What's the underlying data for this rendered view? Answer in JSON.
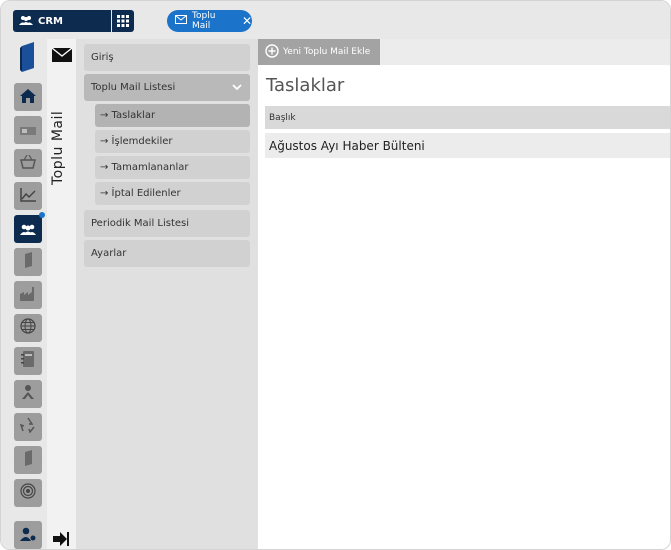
{
  "topbar": {
    "app_label": "CRM",
    "tab_label": "Toplu Mail",
    "tab_close": "✕"
  },
  "rail": {
    "icons": [
      "logo-icon",
      "home-icon",
      "card-icon",
      "basket-icon",
      "chart-icon",
      "users-icon",
      "book-icon",
      "factory-icon",
      "globe-icon",
      "notebook-icon",
      "org-icon",
      "recycle-icon",
      "book2-icon",
      "target-icon",
      "user-settings-icon"
    ]
  },
  "strip": {
    "title": "Toplu Mail"
  },
  "menu": {
    "items": [
      {
        "label": "Giriş"
      },
      {
        "label": "Toplu Mail Listesi"
      },
      {
        "label": "Periodik Mail Listesi"
      },
      {
        "label": "Ayarlar"
      }
    ],
    "sub_items": [
      {
        "label": "→ Taslaklar"
      },
      {
        "label": "→ İşlemdekiler"
      },
      {
        "label": "→ Tamamlananlar"
      },
      {
        "label": "→ İptal Edilenler"
      }
    ]
  },
  "content": {
    "new_button_label": "Yeni Toplu Mail Ekle",
    "page_title": "Taslaklar",
    "table": {
      "header": "Başlık",
      "rows": [
        {
          "title": "Ağustos Ayı Haber Bülteni"
        }
      ]
    }
  },
  "colors": {
    "navy": "#0d2a4f",
    "accent_blue": "#1b74c9"
  }
}
